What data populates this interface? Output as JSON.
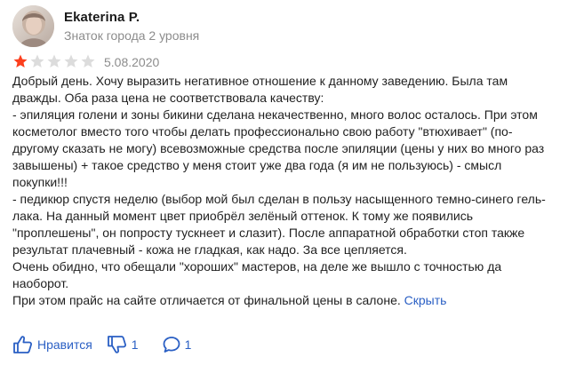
{
  "author": {
    "name": "Ekaterina P.",
    "level": "Знаток города 2 уровня",
    "avatar_icon": "user-avatar-photo"
  },
  "rating": {
    "value": 1,
    "max": 5,
    "filled_color": "#fc3f1d",
    "empty_color": "#dcdcdc"
  },
  "date": "5.08.2020",
  "review_text": {
    "lines": [
      "Добрый день. Хочу выразить негативное отношение к данному заведению. Была там дважды. Оба раза цена не соответствовала качеству:",
      "- эпиляция голени и зоны бикини сделана некачественно, много волос осталось. При этом косметолог вместо того чтобы делать профессионально свою работу \"втюхивает\" (по-другому сказать не могу) всевозможные средства после эпиляции (цены у них во много раз завышены) + такое средство у меня стоит уже два года (я им не пользуюсь) - смысл покупки!!!",
      "- педикюр спустя неделю (выбор мой был сделан в пользу насыщенного темно-синего гель-лака. На данный момент цвет приобрёл зелёный оттенок. К тому же появились \"проплешены\", он попросту тускнеет и слазит). После аппаратной обработки стоп также результат плачевный - кожа не гладкая, как надо. За все цепляется.",
      "Очень обидно, что обещали \"хороших\" мастеров, на деле же вышло с точностью да наоборот."
    ],
    "last_line": "При этом прайс на сайте отличается от финальной цены в салоне.",
    "hide_link": "Скрыть"
  },
  "actions": {
    "like_label": "Нравится",
    "dislike_count": "1",
    "comment_count": "1",
    "accent_color": "#2a5fc4"
  }
}
